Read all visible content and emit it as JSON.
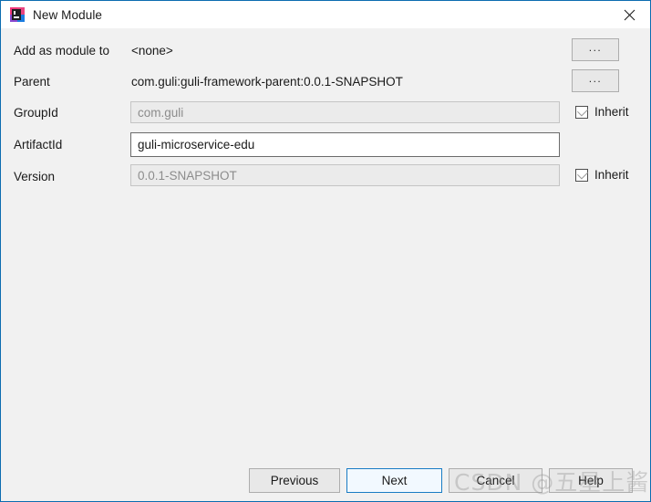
{
  "window": {
    "title": "New Module",
    "icon": "intellij-idea-logo",
    "close_label": "✕",
    "border_color": "#0c6cb0",
    "titlebar_bg": "#ffffff",
    "body_bg": "#f1f1f1"
  },
  "form": {
    "rows": [
      {
        "label": "Add as module to",
        "value": "<none>",
        "kind": "static",
        "browse_label": "...",
        "has_browse": true
      },
      {
        "label": "Parent",
        "value": "com.guli:guli-framework-parent:0.0.1-SNAPSHOT",
        "kind": "static",
        "browse_label": "...",
        "has_browse": true
      },
      {
        "label": "GroupId",
        "value": "com.guli",
        "kind": "input-disabled",
        "inherit_label": "Inherit",
        "inherit_checked": true
      },
      {
        "label": "ArtifactId",
        "value": "guli-microservice-edu",
        "kind": "input",
        "inherit_label": "",
        "inherit_checked": false
      },
      {
        "label": "Version",
        "value": "0.0.1-SNAPSHOT",
        "kind": "input-disabled",
        "inherit_label": "Inherit",
        "inherit_checked": true
      }
    ]
  },
  "footer": {
    "previous_label": "Previous",
    "next_label": "Next",
    "cancel_label": "Cancel",
    "help_label": "Help",
    "default_button": "Next",
    "default_accent": "#1a7cc4"
  },
  "watermark": {
    "text": "CSDN @五星上酱"
  }
}
